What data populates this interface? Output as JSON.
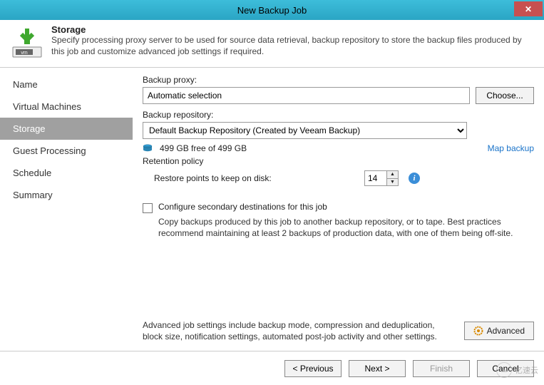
{
  "window": {
    "title": "New Backup Job"
  },
  "header": {
    "title": "Storage",
    "description": "Specify processing proxy server to be used for source data retrieval, backup repository to store the backup files produced by this job and customize advanced job settings if required."
  },
  "sidebar": {
    "items": [
      {
        "label": "Name"
      },
      {
        "label": "Virtual Machines"
      },
      {
        "label": "Storage"
      },
      {
        "label": "Guest Processing"
      },
      {
        "label": "Schedule"
      },
      {
        "label": "Summary"
      }
    ],
    "active_index": 2
  },
  "main": {
    "proxy_label": "Backup proxy:",
    "proxy_value": "Automatic selection",
    "choose_label": "Choose...",
    "repo_label": "Backup repository:",
    "repo_selected": "Default Backup Repository (Created by Veeam Backup)",
    "free_space": "499 GB free of 499 GB",
    "map_backup": "Map backup",
    "retention_label": "Retention policy",
    "restore_label": "Restore points to keep on disk:",
    "restore_points": "14",
    "secondary_label": "Configure secondary destinations for this job",
    "secondary_desc": "Copy backups produced by this job to another backup repository, or to tape. Best practices recommend maintaining at least 2 backups of production data, with one of them being off-site.",
    "advanced_desc": "Advanced job settings include backup mode, compression and deduplication, block size, notification settings, automated post-job activity and other settings.",
    "advanced_label": "Advanced"
  },
  "footer": {
    "previous": "< Previous",
    "next": "Next >",
    "finish": "Finish",
    "cancel": "Cancel"
  },
  "watermark": {
    "text": "亿速云"
  }
}
